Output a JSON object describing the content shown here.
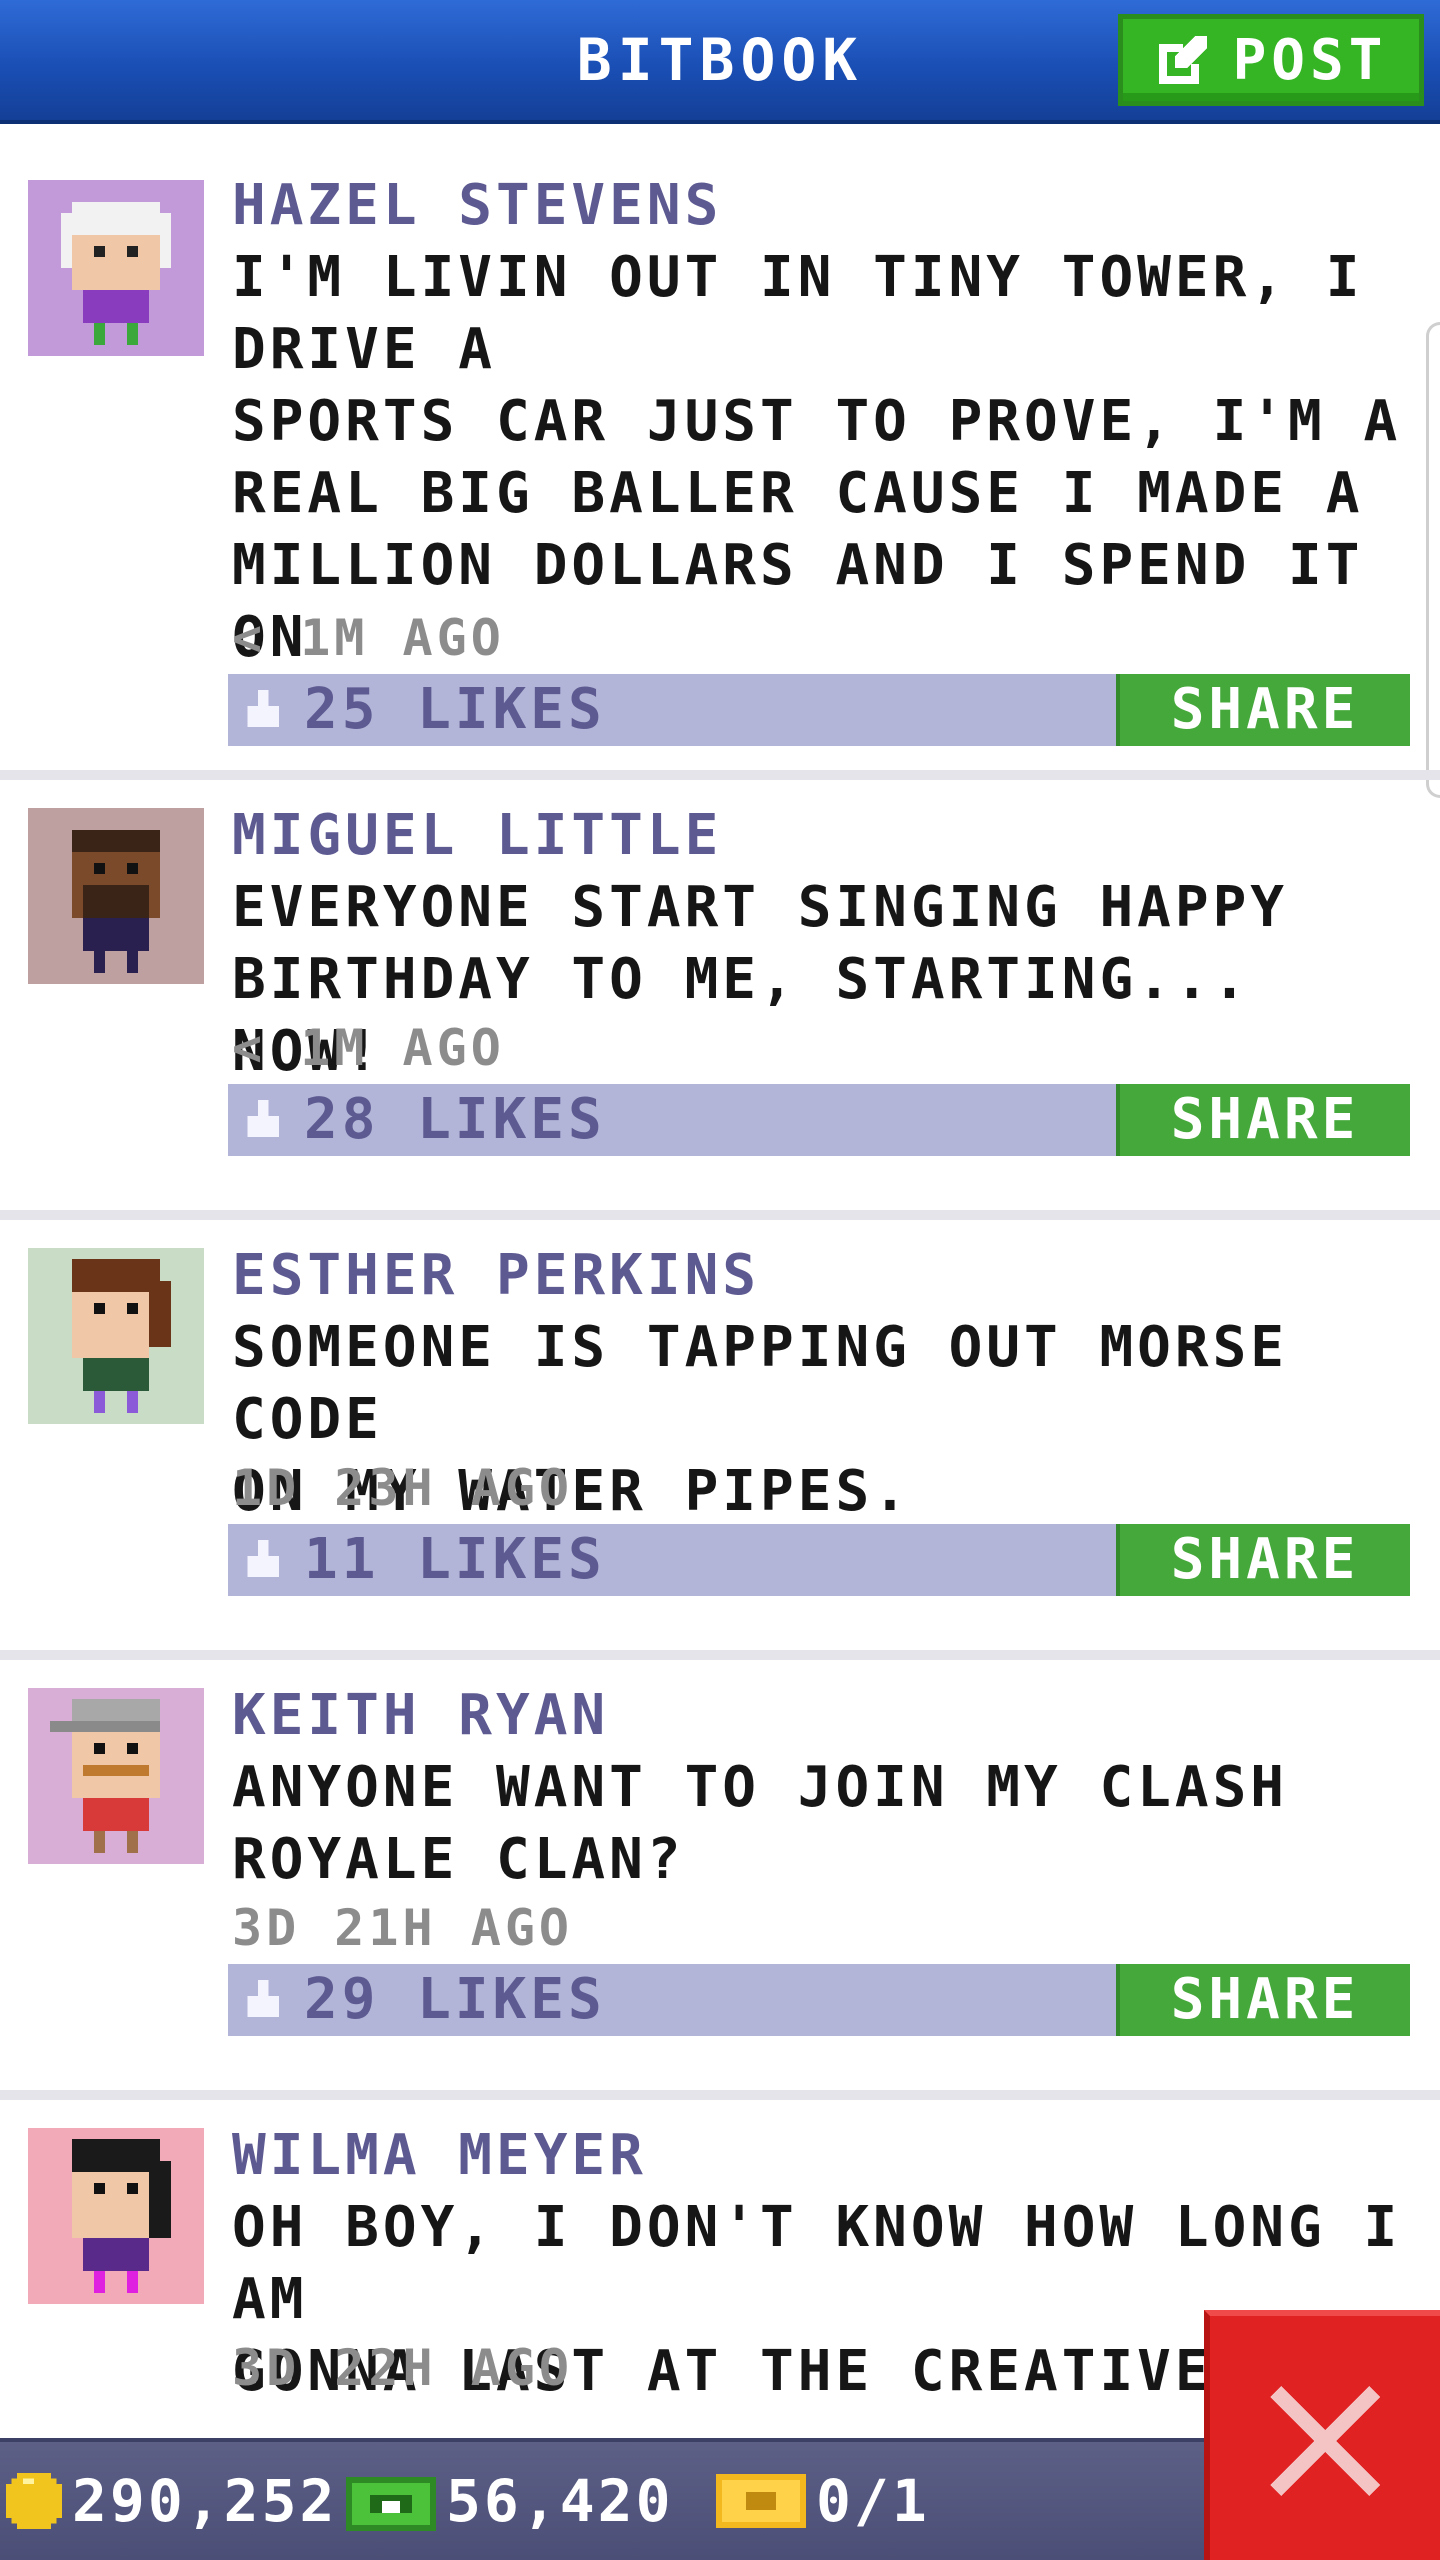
{
  "header": {
    "title": "BITBOOK",
    "post_label": "POST"
  },
  "posts": [
    {
      "name": "HAZEL STEVENS",
      "message": "I'M LIVIN OUT IN TINY TOWER, I DRIVE A\nSPORTS CAR JUST TO PROVE, I'M A\nREAL BIG BALLER CAUSE I MADE A\nMILLION DOLLARS AND I SPEND IT ON\nBUX AND SHOES.",
      "time": "< 1M AGO",
      "likes": "25 LIKES",
      "share": "SHARE"
    },
    {
      "name": "MIGUEL LITTLE",
      "message": "EVERYONE START SINGING HAPPY\nBIRTHDAY TO ME, STARTING... NOW!",
      "time": "< 1M AGO",
      "likes": "28 LIKES",
      "share": "SHARE"
    },
    {
      "name": "ESTHER PERKINS",
      "message": "SOMEONE IS TAPPING OUT MORSE CODE\nON MY WATER PIPES.",
      "time": "1D 23H AGO",
      "likes": "11 LIKES",
      "share": "SHARE"
    },
    {
      "name": "KEITH RYAN",
      "message": "ANYONE WANT TO JOIN MY CLASH\nROYALE CLAN?",
      "time": "3D 21H AGO",
      "likes": "29 LIKES",
      "share": "SHARE"
    },
    {
      "name": "WILMA MEYER",
      "message": "OH BOY, I DON'T KNOW HOW LONG I AM\nGONNA LAST AT THE CREATIVE INK",
      "time": "3D 22H AGO"
    }
  ],
  "footer": {
    "coins": "290,252",
    "bux": "56,420",
    "tickets": "0/1"
  },
  "icons": {
    "post": "edit-icon",
    "like": "thumbs-up-icon",
    "coin": "coin-icon",
    "bux": "bux-icon",
    "ticket": "ticket-icon",
    "close": "close-icon"
  },
  "colors": {
    "header": "#1a4fb5",
    "accent_green": "#44a83a",
    "like_bar": "#b2b5d7",
    "name": "#5d5a92",
    "close": "#e02222"
  }
}
